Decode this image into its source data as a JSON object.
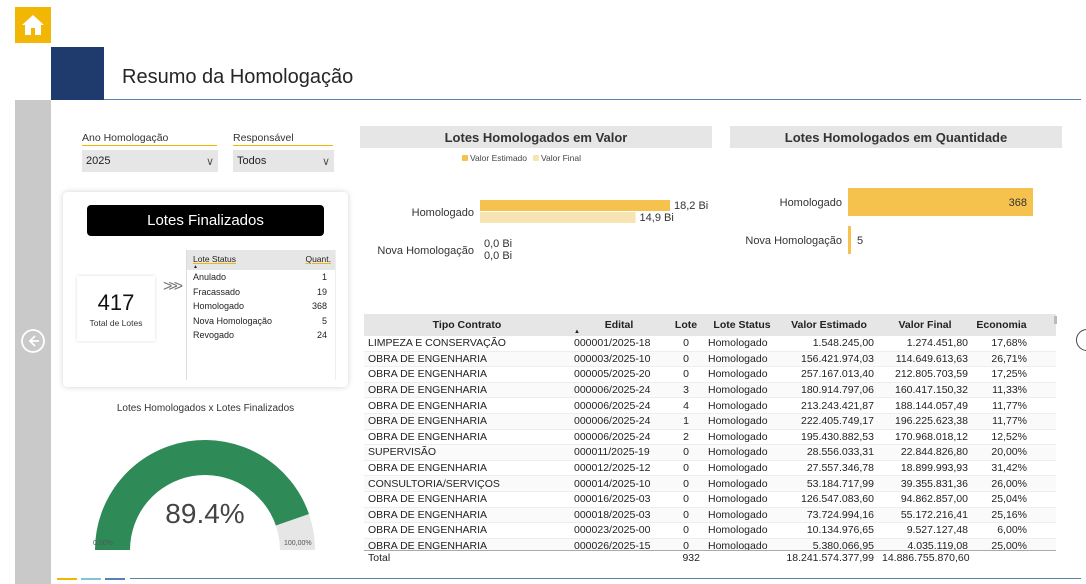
{
  "colors": {
    "accent": "#f2b705",
    "valor_estimado": "#f5c24e",
    "valor_final": "#f7e4b3",
    "navy": "#1f3b6e",
    "gauge_fill": "#2e8b57",
    "gauge_rest": "#e6e6e6"
  },
  "header": {
    "title": "Resumo da Homologação",
    "home_icon": "home-icon"
  },
  "filters": {
    "ano": {
      "label": "Ano Homologação",
      "value": "2025"
    },
    "responsavel": {
      "label": "Responsável",
      "value": "Todos"
    }
  },
  "lotes_finalizados": {
    "title": "Lotes Finalizados",
    "total_value": "417",
    "total_label": "Total de Lotes",
    "table_headers": [
      "Lote Status",
      "Quant."
    ],
    "rows": [
      {
        "status": "Anulado",
        "quant": "1"
      },
      {
        "status": "Fracassado",
        "quant": "19"
      },
      {
        "status": "Homologado",
        "quant": "368"
      },
      {
        "status": "Nova Homologação",
        "quant": "5"
      },
      {
        "status": "Revogado",
        "quant": "24"
      }
    ]
  },
  "gauge": {
    "title": "Lotes Homologados x Lotes Finalizados",
    "value_label": "89.4%",
    "value": 0.894,
    "min_label": "0,00%",
    "max_label": "100,00%"
  },
  "valor_chart": {
    "title": "Lotes Homologados em Valor",
    "legend": [
      "Valor Estimado",
      "Valor Final"
    ]
  },
  "quant_chart": {
    "title": "Lotes Homologados em Quantidade"
  },
  "chart_data": [
    {
      "type": "bar",
      "orientation": "horizontal",
      "categories": [
        "Homologado",
        "Nova Homologação"
      ],
      "series": [
        {
          "name": "Valor Estimado",
          "values": [
            18.2,
            0.0
          ],
          "labels": [
            "18,2 Bi",
            "0,0 Bi"
          ]
        },
        {
          "name": "Valor Final",
          "values": [
            14.9,
            0.0
          ],
          "labels": [
            "14,9 Bi",
            "0,0 Bi"
          ]
        }
      ],
      "title": "Lotes Homologados em Valor",
      "legend_position": "top"
    },
    {
      "type": "bar",
      "orientation": "horizontal",
      "categories": [
        "Homologado",
        "Nova Homologação"
      ],
      "values": [
        368,
        5
      ],
      "labels": [
        "368",
        "5"
      ],
      "title": "Lotes Homologados em Quantidade"
    }
  ],
  "table": {
    "headers": [
      "Tipo Contrato",
      "Edital",
      "Lote",
      "Lote Status",
      "Valor Estimado",
      "Valor Final",
      "Economia"
    ],
    "rows": [
      [
        "LIMPEZA E CONSERVAÇÃO",
        "000001/2025-18",
        "0",
        "Homologado",
        "1.548.245,00",
        "1.274.451,80",
        "17,68%"
      ],
      [
        "OBRA DE ENGENHARIA",
        "000003/2025-10",
        "0",
        "Homologado",
        "156.421.974,03",
        "114.649.613,63",
        "26,71%"
      ],
      [
        "OBRA DE ENGENHARIA",
        "000005/2025-20",
        "0",
        "Homologado",
        "257.167.013,40",
        "212.805.703,59",
        "17,25%"
      ],
      [
        "OBRA DE ENGENHARIA",
        "000006/2025-24",
        "3",
        "Homologado",
        "180.914.797,06",
        "160.417.150,32",
        "11,33%"
      ],
      [
        "OBRA DE ENGENHARIA",
        "000006/2025-24",
        "4",
        "Homologado",
        "213.243.421,87",
        "188.144.057,49",
        "11,77%"
      ],
      [
        "OBRA DE ENGENHARIA",
        "000006/2025-24",
        "1",
        "Homologado",
        "222.405.749,17",
        "196.225.623,38",
        "11,77%"
      ],
      [
        "OBRA DE ENGENHARIA",
        "000006/2025-24",
        "2",
        "Homologado",
        "195.430.882,53",
        "170.968.018,12",
        "12,52%"
      ],
      [
        "SUPERVISÃO",
        "000011/2025-19",
        "0",
        "Homologado",
        "28.556.033,31",
        "22.844.826,80",
        "20,00%"
      ],
      [
        "OBRA DE ENGENHARIA",
        "000012/2025-12",
        "0",
        "Homologado",
        "27.557.346,78",
        "18.899.993,93",
        "31,42%"
      ],
      [
        "CONSULTORIA/SERVIÇOS",
        "000014/2025-10",
        "0",
        "Homologado",
        "53.184.717,99",
        "39.355.831,36",
        "26,00%"
      ],
      [
        "OBRA DE ENGENHARIA",
        "000016/2025-03",
        "0",
        "Homologado",
        "126.547.083,60",
        "94.862.857,00",
        "25,04%"
      ],
      [
        "OBRA DE ENGENHARIA",
        "000018/2025-03",
        "0",
        "Homologado",
        "73.724.994,16",
        "55.172.216,41",
        "25,16%"
      ],
      [
        "OBRA DE ENGENHARIA",
        "000023/2025-00",
        "0",
        "Homologado",
        "10.134.976,65",
        "9.527.127,48",
        "6,00%"
      ],
      [
        "OBRA DE ENGENHARIA",
        "000026/2025-15",
        "0",
        "Homologado",
        "5.380.066,95",
        "4.035.119,08",
        "25,00%"
      ]
    ],
    "total": {
      "label": "Total",
      "lote": "932",
      "valor_estimado": "18.241.574.377,99",
      "valor_final": "14.886.755.870,60"
    }
  }
}
